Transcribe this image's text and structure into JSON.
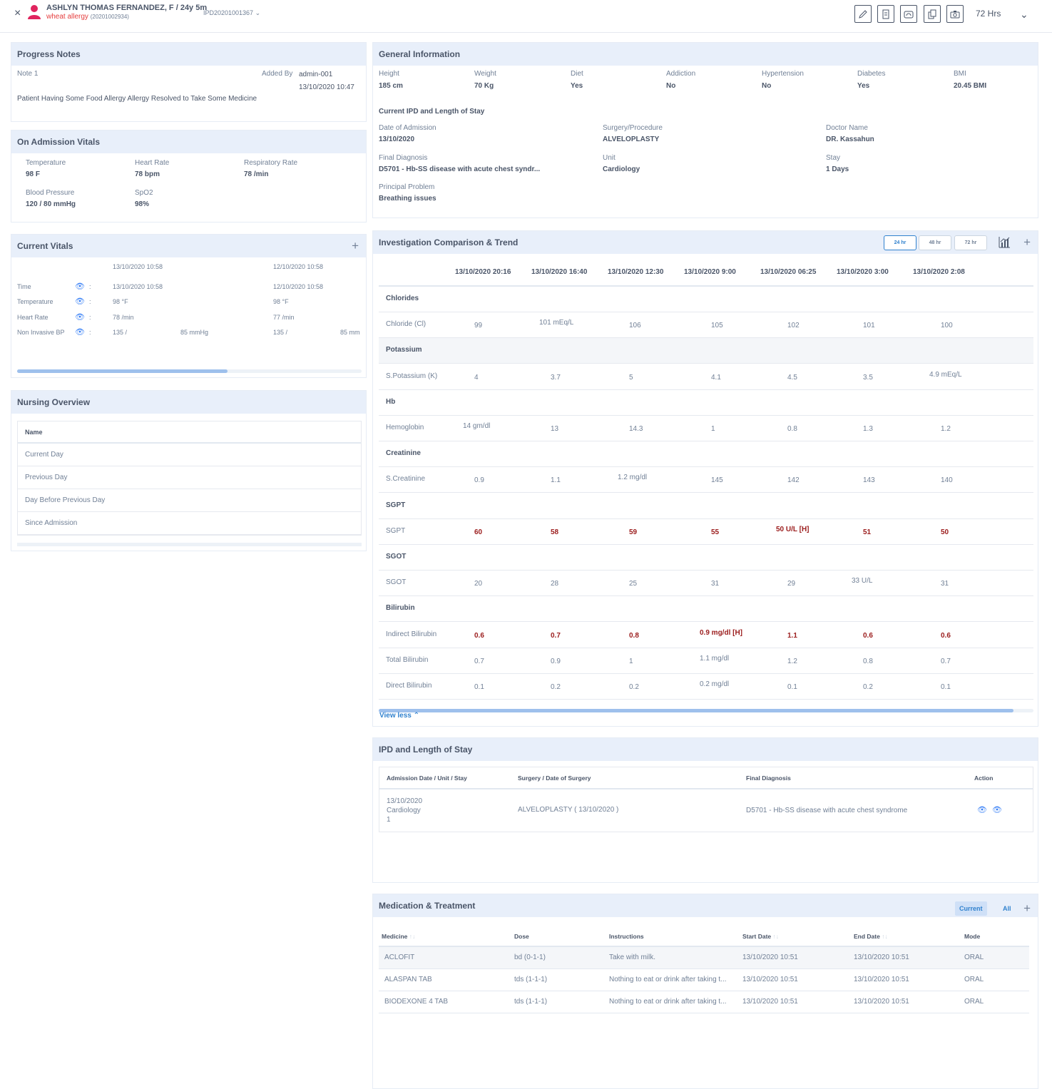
{
  "header": {
    "close": "×",
    "patient_name": "ASHLYN THOMAS FERNANDEZ, F / 24y 5m",
    "allergy": "wheat allergy",
    "patient_id": "(20201002934)",
    "ipd_number": "IPD20201001367",
    "hours": "72 Hrs",
    "tools": [
      "edit-icon",
      "document-icon",
      "dashboard-icon",
      "copy-icon",
      "camera-icon"
    ]
  },
  "progress_notes": {
    "title": "Progress Notes",
    "note_label": "Note 1",
    "added_by_label": "Added By",
    "added_by": "admin-001",
    "datetime": "13/10/2020 10:47",
    "text": "Patient Having Some Food Allergy Allergy Resolved to Take Some Medicine"
  },
  "admission_vitals": {
    "title": "On Admission Vitals",
    "items": [
      {
        "label": "Temperature",
        "value": "98 F"
      },
      {
        "label": "Heart Rate",
        "value": "78 bpm"
      },
      {
        "label": "Respiratory Rate",
        "value": "78 /min"
      },
      {
        "label": "Blood Pressure",
        "value": "120 / 80 mmHg"
      },
      {
        "label": "SpO2",
        "value": "98%"
      }
    ]
  },
  "current_vitals": {
    "title": "Current Vitals",
    "col1_date": "13/10/2020 10:58",
    "col2_date": "12/10/2020 10:58",
    "rows": [
      {
        "label": "Time",
        "v1": "13/10/2020 10:58",
        "v1b": "",
        "v2": "12/10/2020 10:58",
        "v2b": ""
      },
      {
        "label": "Temperature",
        "v1": "98 °F",
        "v1b": "",
        "v2": "98 °F",
        "v2b": ""
      },
      {
        "label": "Heart Rate",
        "v1": "78 /min",
        "v1b": "",
        "v2": "77 /min",
        "v2b": ""
      },
      {
        "label": "Non Invasive BP",
        "v1": "135 /",
        "v1b": "85 mmHg",
        "v2": "135 /",
        "v2b": "85 mm"
      }
    ],
    "colon": ":",
    "scroll_fraction": 0.61
  },
  "nursing": {
    "title": "Nursing Overview",
    "header": "Name",
    "rows": [
      "Current Day",
      "Previous Day",
      "Day Before Previous Day",
      "Since Admission"
    ]
  },
  "general": {
    "title": "General Information",
    "stats": [
      {
        "label": "Height",
        "value": "185 cm"
      },
      {
        "label": "Weight",
        "value": "70 Kg"
      },
      {
        "label": "Diet",
        "value": "Yes"
      },
      {
        "label": "Addiction",
        "value": "No"
      },
      {
        "label": "Hypertension",
        "value": "No"
      },
      {
        "label": "Diabetes",
        "value": "Yes"
      },
      {
        "label": "BMI",
        "value": "20.45 BMI"
      }
    ],
    "stay_title": "Current IPD and Length of Stay",
    "stay": [
      {
        "label": "Date of Admission",
        "value": "13/10/2020"
      },
      {
        "label": "Surgery/Procedure",
        "value": "ALVELOPLASTY"
      },
      {
        "label": "Doctor Name",
        "value": "DR. Kassahun"
      },
      {
        "label": "Final Diagnosis",
        "value": "D5701 - Hb-SS disease with acute chest syndr..."
      },
      {
        "label": "Unit",
        "value": "Cardiology"
      },
      {
        "label": "Stay",
        "value": "1 Days"
      },
      {
        "label": "Principal Problem",
        "value": "Breathing issues"
      }
    ]
  },
  "investigation": {
    "title": "Investigation Comparison & Trend",
    "ranges": [
      "24 hr",
      "48 hr",
      "72 hr"
    ],
    "columns": [
      "13/10/2020 20:16",
      "13/10/2020 16:40",
      "13/10/2020 12:30",
      "13/10/2020  9:00",
      "13/10/2020  06:25",
      "13/10/2020 3:00",
      "13/10/2020  2:08"
    ],
    "rows": [
      {
        "type": "group",
        "name": "Chlorides"
      },
      {
        "type": "test",
        "name": "Chloride (Cl)",
        "values": [
          "99",
          "101 mEq/L",
          "106",
          "105",
          "102",
          "101",
          "100"
        ],
        "high": false
      },
      {
        "type": "group",
        "name": "Potassium",
        "shaded": true
      },
      {
        "type": "test",
        "name": "S.Potassium (K)",
        "values": [
          "4",
          "3.7",
          "5",
          "4.1",
          "4.5",
          "3.5",
          "4.9 mEq/L"
        ],
        "high": false
      },
      {
        "type": "group",
        "name": "Hb"
      },
      {
        "type": "test",
        "name": "Hemoglobin",
        "values": [
          "14 gm/dl",
          "13",
          "14.3",
          "1",
          "0.8",
          "1.3",
          "1.2"
        ],
        "high": false
      },
      {
        "type": "group",
        "name": "Creatinine"
      },
      {
        "type": "test",
        "name": "S.Creatinine",
        "values": [
          "0.9",
          "1.1",
          "1.2 mg/dl",
          "145",
          "142",
          "143",
          "140"
        ],
        "high": false
      },
      {
        "type": "group",
        "name": "SGPT"
      },
      {
        "type": "test",
        "name": "SGPT",
        "values": [
          "60",
          "58",
          "59",
          "55",
          "50 U/L [H]",
          "51",
          "50"
        ],
        "high": true
      },
      {
        "type": "group",
        "name": "SGOT"
      },
      {
        "type": "test",
        "name": "SGOT",
        "values": [
          "20",
          "28",
          "25",
          "31",
          "29",
          "33 U/L",
          "31"
        ],
        "high": false
      },
      {
        "type": "group",
        "name": "Bilirubin"
      },
      {
        "type": "test",
        "name": "Indirect Bilirubin",
        "values": [
          "0.6",
          "0.7",
          "0.8",
          "0.9 mg/dl [H]",
          "1.1",
          "0.6",
          "0.6"
        ],
        "high": true
      },
      {
        "type": "test",
        "name": "Total Bilirubin",
        "values": [
          "0.7",
          "0.9",
          "1",
          "1.1 mg/dl",
          "1.2",
          "0.8",
          "0.7"
        ],
        "high": false
      },
      {
        "type": "test",
        "name": "Direct Bilirubin",
        "values": [
          "0.1",
          "0.2",
          "0.2",
          "0.2 mg/dl",
          "0.1",
          "0.2",
          "0.1"
        ],
        "high": false
      }
    ],
    "view_less": "View less",
    "scroll_fraction": 0.97
  },
  "ipd": {
    "title": "IPD and Length of Stay",
    "headers": [
      "Admission Date / Unit / Stay",
      "Surgery / Date of Surgery",
      "Final Diagnosis",
      "Action"
    ],
    "row": {
      "date": "13/10/2020",
      "unit": "Cardiology",
      "stay": "1",
      "surgery": "ALVELOPLASTY   ( 13/10/2020 )",
      "diagnosis": "D5701 - Hb-SS disease with acute chest syndrome"
    }
  },
  "medication": {
    "title": "Medication & Treatment",
    "tabs": [
      "Current",
      "All"
    ],
    "headers": [
      "Medicine",
      "Dose",
      "Instructions",
      "Start Date",
      "End Date",
      "Mode"
    ],
    "rows": [
      {
        "medicine": "ACLOFIT",
        "dose": "bd (0-1-1)",
        "instructions": "Take with milk.",
        "start": "13/10/2020 10:51",
        "end": "13/10/2020 10:51",
        "mode": "ORAL"
      },
      {
        "medicine": "ALASPAN TAB",
        "dose": "tds (1-1-1)",
        "instructions": "Nothing to eat or drink after taking t...",
        "start": "13/10/2020 10:51",
        "end": "13/10/2020 10:51",
        "mode": "ORAL"
      },
      {
        "medicine": "BIODEXONE 4 TAB",
        "dose": "tds (1-1-1)",
        "instructions": "Nothing to eat or drink after taking t...",
        "start": "13/10/2020 10:51",
        "end": "13/10/2020 10:51",
        "mode": "ORAL"
      }
    ]
  },
  "colors": {
    "accent": "#3182ce",
    "panel_header": "#e8effa",
    "high_value": "#9b1c1c",
    "allergy": "#e53e3e",
    "avatar": "#e0245e"
  }
}
